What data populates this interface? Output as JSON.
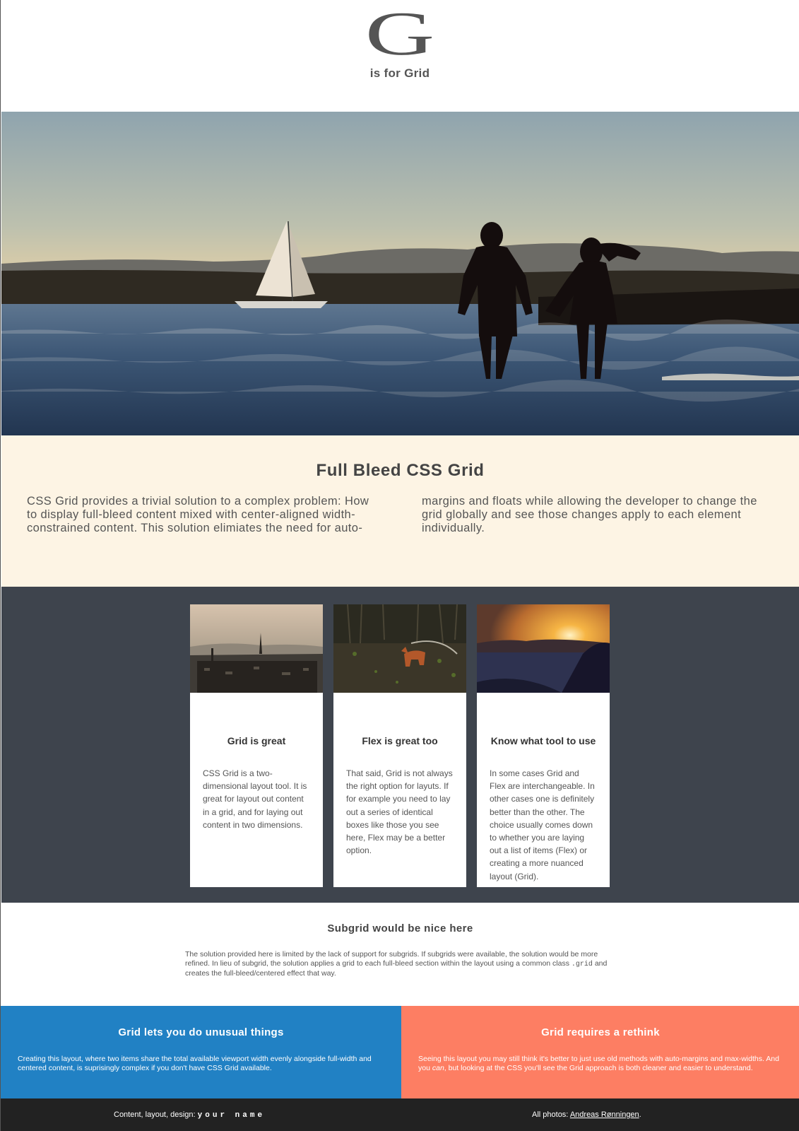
{
  "masthead": {
    "letter": "G",
    "tagline": "is for Grid"
  },
  "hero": {
    "image": "silhouette-couple-sea-sailboat"
  },
  "intro": {
    "title": "Full Bleed CSS Grid",
    "body": "CSS Grid provides a trivial solution to a complex problem: How to display full-bleed content mixed with center-aligned width-constrained content. This solution elimiates the need for auto-margins and floats while allowing the developer to change the grid globally and see those changes apply to each element individually."
  },
  "cards": [
    {
      "image": "city-skyline-photo",
      "title": "Grid is great",
      "body": "CSS Grid is a two-dimensional layout tool. It is great for layout out content in a grid, and for laying out content in two dimensions."
    },
    {
      "image": "fox-in-forest-photo",
      "title": "Flex is great too",
      "body": "That said, Grid is not always the right option for layuts. If for example you need to lay out a series of identical boxes like those you see here, Flex may be a better option."
    },
    {
      "image": "sunset-coast-photo",
      "title": "Know what tool to use",
      "body": "In some cases Grid and Flex are interchangeable. In other cases one is definitely better than the other. The choice usually comes down to whether you are laying out a list of items (Flex) or creating a more nuanced layout (Grid)."
    }
  ],
  "subgrid": {
    "title": "Subgrid would be nice here",
    "body_before": "The solution provided here is limited by the lack of support for subgrids. If subgrids were available, the solution would be more refined. In lieu of subgrid, the solution applies a grid to each full-bleed section within the layout using a common class ",
    "code": ".grid",
    "body_after": " and creates the full-bleed/centered effect that way."
  },
  "panels": {
    "left": {
      "title": "Grid lets you do unusual things",
      "body": "Creating this layout, where two items share the total available viewport width evenly alongside full-width and centered content, is suprisingly complex if you don't have CSS Grid available."
    },
    "right": {
      "title": "Grid requires a rethink",
      "body_before": "Seeing this layout you may still think it's better to just use old methods with auto-margins and max-widths. And you ",
      "body_em": "can",
      "body_after": ", but looking at the CSS you'll see the Grid approach is both cleaner and easier to understand."
    }
  },
  "footer": {
    "credit_label": "Content, layout, design: ",
    "credit_name": "your name",
    "photos_label": "All photos: ",
    "photos_link": "Andreas Rønningen",
    "photos_end": "."
  },
  "colors": {
    "cream": "#fdf4e4",
    "slate": "#3e444d",
    "blue": "#2181c4",
    "coral": "#fd7e63",
    "footer": "#222222"
  }
}
